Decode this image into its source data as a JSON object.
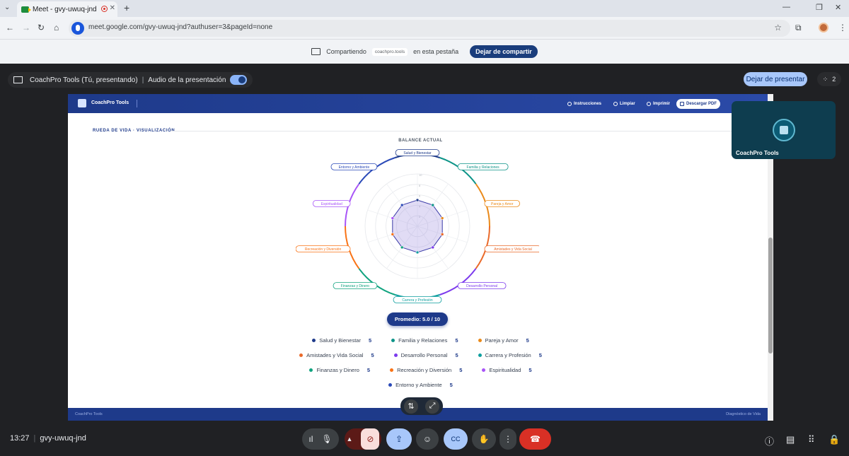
{
  "browser": {
    "tab_title": "Meet - gvy-uwuq-jnd",
    "tab_close": "✕",
    "new_tab": "+",
    "url": "meet.google.com/gvy-uwuq-jnd?authuser=3&pageId=none"
  },
  "share_banner": {
    "prefix": "Compartiendo",
    "site": "coachpro.tools",
    "suffix": "en esta pestaña",
    "stop_label": "Dejar de compartir"
  },
  "meet_header": {
    "presenter": "CoachPro Tools (Tú, presentando)",
    "audio_label": "Audio de la presentación",
    "stop_presenting": "Dejar de presentar",
    "participants": "2"
  },
  "app": {
    "brand": "CoachPro Tools",
    "nav": [
      "Instrucciones",
      "Limpiar",
      "Imprimir",
      "Descargar PDF"
    ],
    "section_title": "RUEDA DE VIDA · VISUALIZACIÓN",
    "chart_title": "BALANCE ACTUAL",
    "average": "Promedio: 5.0 / 10",
    "footer_left": "CoachPro Tools",
    "footer_right": "Diagnóstico de Vida"
  },
  "chart_data": {
    "type": "radar",
    "title": "BALANCE ACTUAL",
    "rmax": 10,
    "categories": [
      "Salud y Bienestar",
      "Familia y Relaciones",
      "Pareja y Amor",
      "Amistades y Vida Social",
      "Desarrollo Personal",
      "Carrera y Profesión",
      "Finanzas y Dinero",
      "Recreación y Diversión",
      "Espiritualidad",
      "Entorno y Ambiente"
    ],
    "values": [
      5,
      5,
      5,
      5,
      5,
      5,
      5,
      5,
      5,
      5
    ],
    "colors": [
      "#1e3a8a",
      "#0d9488",
      "#ea8a1a",
      "#ea6a2a",
      "#7c3aed",
      "#0e9f9f",
      "#10a37f",
      "#f97316",
      "#a855f7",
      "#2b4ab8"
    ],
    "tick_labels": [
      "10",
      "8",
      "6",
      "4",
      "2"
    ]
  },
  "legend_rows": [
    [
      {
        "label": "Salud y Bienestar",
        "value": "5",
        "color": "#1e3a8a"
      },
      {
        "label": "Familia y Relaciones",
        "value": "5",
        "color": "#0d9488"
      },
      {
        "label": "Pareja y Amor",
        "value": "5",
        "color": "#ea8a1a"
      }
    ],
    [
      {
        "label": "Amistades y Vida Social",
        "value": "5",
        "color": "#ea6a2a"
      },
      {
        "label": "Desarrollo Personal",
        "value": "5",
        "color": "#7c3aed"
      },
      {
        "label": "Carrera y Profesión",
        "value": "5",
        "color": "#0e9f9f"
      }
    ],
    [
      {
        "label": "Finanzas y Dinero",
        "value": "5",
        "color": "#10a37f"
      },
      {
        "label": "Recreación y Diversión",
        "value": "5",
        "color": "#f97316"
      },
      {
        "label": "Espiritualidad",
        "value": "5",
        "color": "#a855f7"
      }
    ],
    [
      {
        "label": "Entorno y Ambiente",
        "value": "5",
        "color": "#2b4ab8"
      }
    ]
  ],
  "self_tile": {
    "name": "CoachPro Tools"
  },
  "bottom_bar": {
    "time": "13:27",
    "meeting_code": "gvy-uwuq-jnd"
  }
}
